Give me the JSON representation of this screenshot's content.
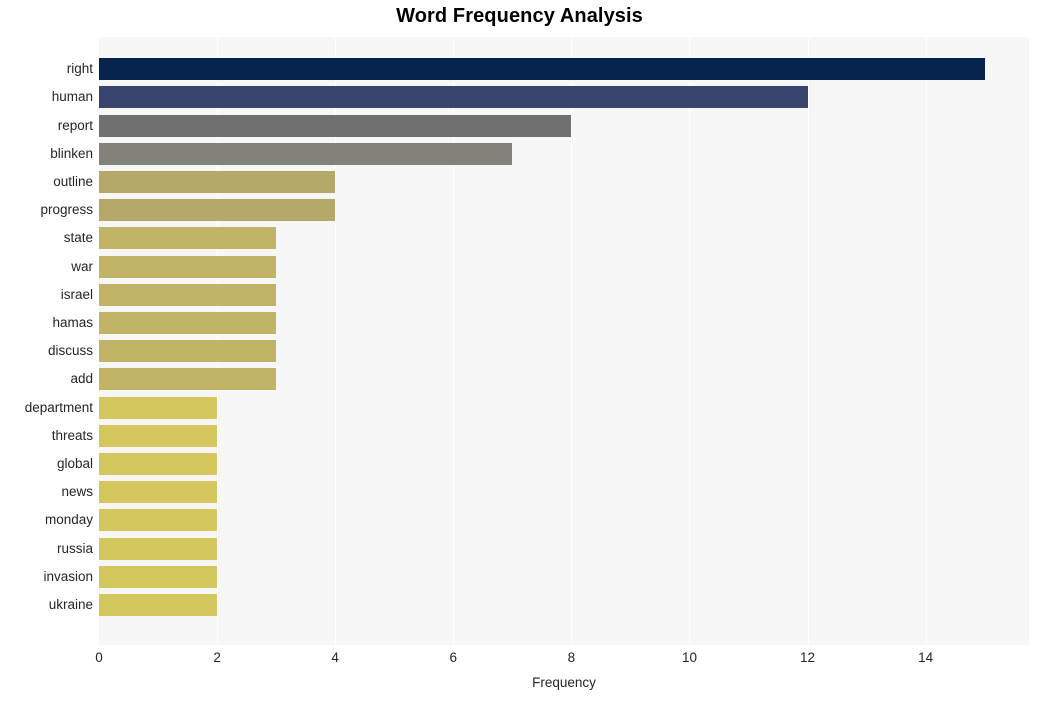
{
  "chart_data": {
    "type": "bar",
    "orientation": "horizontal",
    "title": "Word Frequency Analysis",
    "xlabel": "Frequency",
    "ylabel": "",
    "xlim": [
      0,
      15.75
    ],
    "xticks": [
      0,
      2,
      4,
      6,
      8,
      10,
      12,
      14
    ],
    "xtick_labels": [
      "0",
      "2",
      "4",
      "6",
      "8",
      "10",
      "12",
      "14"
    ],
    "grid": true,
    "grid_axis": "x",
    "legend": false,
    "plot_background": "#f7f7f7",
    "figure_background": "#ffffff",
    "categories": [
      "right",
      "human",
      "report",
      "blinken",
      "outline",
      "progress",
      "state",
      "war",
      "israel",
      "hamas",
      "discuss",
      "add",
      "department",
      "threats",
      "global",
      "news",
      "monday",
      "russia",
      "invasion",
      "ukraine"
    ],
    "values": [
      15,
      12,
      8,
      7,
      4,
      4,
      3,
      3,
      3,
      3,
      3,
      3,
      2,
      2,
      2,
      2,
      2,
      2,
      2,
      2
    ],
    "bar_colors": [
      "#07244d",
      "#394straight",
      "#6f7072",
      "#82817a",
      "#b5a96a",
      "#b5a96a",
      "#c2b467",
      "#c2b467",
      "#c2b467",
      "#c2b467",
      "#c2b467",
      "#c2b467",
      "#d4c75e",
      "#d4c75e",
      "#d4c75e",
      "#d4c75e",
      "#d4c75e",
      "#d4c75e",
      "#d4c75e",
      "#d4c75e"
    ],
    "bars": [
      {
        "label": "right",
        "value": 15,
        "color": "#07244d"
      },
      {
        "label": "human",
        "value": 12,
        "color": "#39456e"
      },
      {
        "label": "report",
        "value": 8,
        "color": "#6f7072"
      },
      {
        "label": "blinken",
        "value": 7,
        "color": "#82817a"
      },
      {
        "label": "outline",
        "value": 4,
        "color": "#b5a96a"
      },
      {
        "label": "progress",
        "value": 4,
        "color": "#b5a96a"
      },
      {
        "label": "state",
        "value": 3,
        "color": "#c2b467"
      },
      {
        "label": "war",
        "value": 3,
        "color": "#c2b467"
      },
      {
        "label": "israel",
        "value": 3,
        "color": "#c2b467"
      },
      {
        "label": "hamas",
        "value": 3,
        "color": "#c2b467"
      },
      {
        "label": "discuss",
        "value": 3,
        "color": "#c2b467"
      },
      {
        "label": "add",
        "value": 3,
        "color": "#c2b467"
      },
      {
        "label": "department",
        "value": 2,
        "color": "#d4c75e"
      },
      {
        "label": "threats",
        "value": 2,
        "color": "#d4c75e"
      },
      {
        "label": "global",
        "value": 2,
        "color": "#d4c75e"
      },
      {
        "label": "news",
        "value": 2,
        "color": "#d4c75e"
      },
      {
        "label": "monday",
        "value": 2,
        "color": "#d4c75e"
      },
      {
        "label": "russia",
        "value": 2,
        "color": "#d4c75e"
      },
      {
        "label": "invasion",
        "value": 2,
        "color": "#d4c75e"
      },
      {
        "label": "ukraine",
        "value": 2,
        "color": "#d4c75e"
      }
    ]
  }
}
